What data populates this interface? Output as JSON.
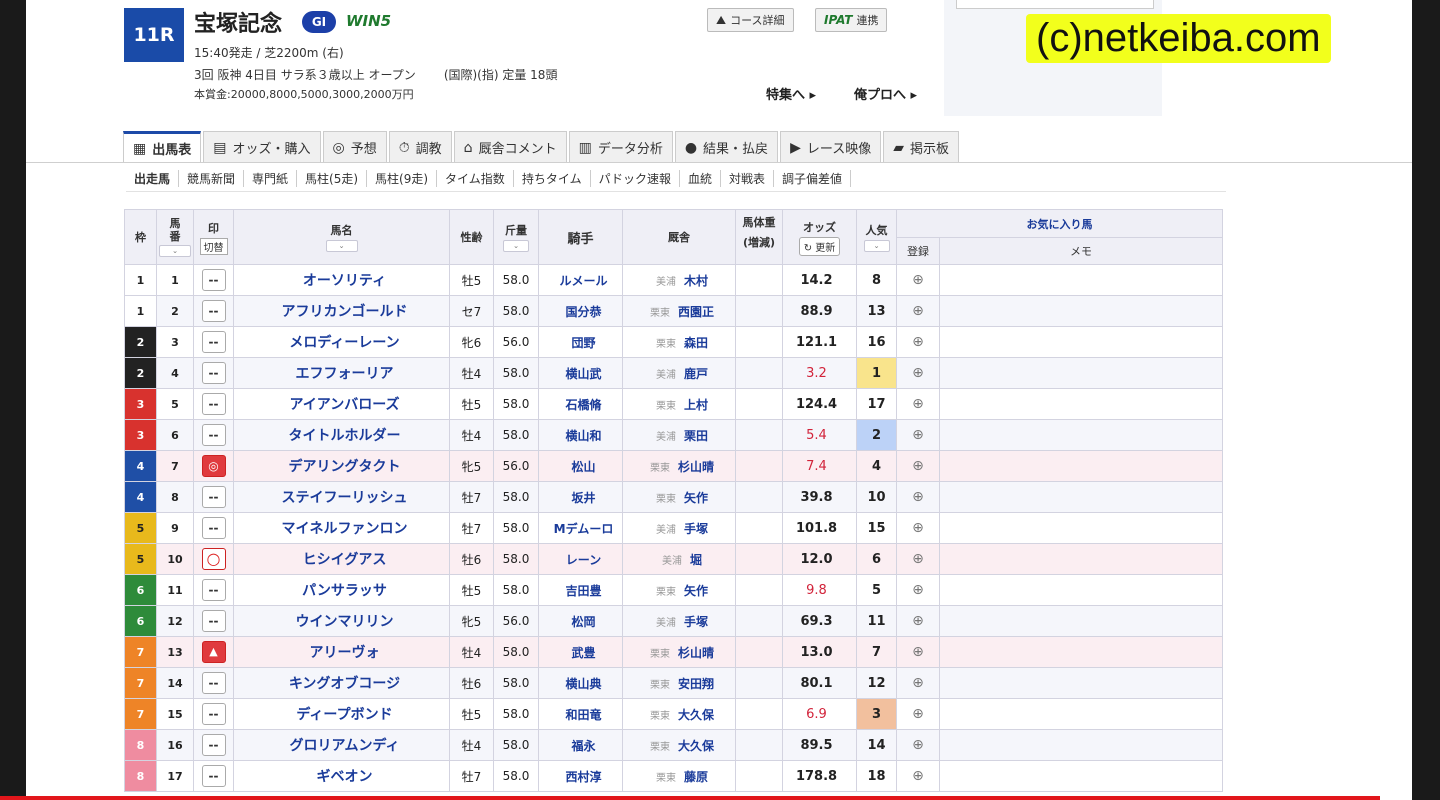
{
  "race": {
    "number": "11R",
    "name": "宝塚記念",
    "grade": "GI",
    "win5": "WIN5",
    "info_line1": "15:40発走 / 芝2200m (右)",
    "info_line2a": "3回 阪神 4日目 サラ系３歳以上 オープン",
    "info_line2b": "(国際)(指) 定量 18頭",
    "prize": "本賞金:20000,8000,5000,3000,2000万円"
  },
  "header": {
    "course_button": "コース詳細",
    "pat_logo": "IPAT",
    "pat_button": "連携",
    "feature_link": "特集へ ▸",
    "blog_link": "俺プロへ ▸",
    "watermark": "(c)netkeiba.com"
  },
  "tabs": [
    {
      "label": "出馬表",
      "icon": "table-icon",
      "glyph": "▦"
    },
    {
      "label": "オッズ・購入",
      "icon": "odds-icon",
      "glyph": "▤"
    },
    {
      "label": "予想",
      "icon": "target-icon",
      "glyph": "◎"
    },
    {
      "label": "調教",
      "icon": "stopwatch-icon",
      "glyph": "⏱"
    },
    {
      "label": "厩舎コメント",
      "icon": "stable-icon",
      "glyph": "⌂"
    },
    {
      "label": "データ分析",
      "icon": "bar-chart-icon",
      "glyph": "▥"
    },
    {
      "label": "結果・払戻",
      "icon": "coins-icon",
      "glyph": "●"
    },
    {
      "label": "レース映像",
      "icon": "video-icon",
      "glyph": "▶"
    },
    {
      "label": "掲示板",
      "icon": "chat-icon",
      "glyph": "▰"
    }
  ],
  "subnav": [
    "出走馬",
    "競馬新聞",
    "専門紙",
    "馬柱(5走)",
    "馬柱(9走)",
    "タイム指数",
    "持ちタイム",
    "パドック速報",
    "血統",
    "対戦表",
    "調子偏差値"
  ],
  "table": {
    "headers": {
      "waku": "枠",
      "umaban": "馬番",
      "mark": "印",
      "mark_toggle": "切替",
      "horse": "馬名",
      "sex_age": "性齢",
      "weight": "斤量",
      "jockey": "騎手",
      "trainer": "厩舎",
      "body_weight": "馬体重",
      "body_weight_sub": "(増減)",
      "odds": "オッズ",
      "odds_update": "更新",
      "popularity": "人気",
      "favorite": "お気に入り馬",
      "register": "登録",
      "memo": "メモ"
    },
    "rows": [
      {
        "waku": "1",
        "umaban": "1",
        "mark": "--",
        "horse": "オーソリティ",
        "sex_age": "牡5",
        "weight": "58.0",
        "jockey": "ルメール",
        "area": "美浦",
        "trainer": "木村",
        "odds": "14.2",
        "ninki": "8"
      },
      {
        "waku": "1",
        "umaban": "2",
        "mark": "--",
        "horse": "アフリカンゴールド",
        "sex_age": "セ7",
        "weight": "58.0",
        "jockey": "国分恭",
        "area": "栗東",
        "trainer": "西園正",
        "odds": "88.9",
        "ninki": "13"
      },
      {
        "waku": "2",
        "umaban": "3",
        "mark": "--",
        "horse": "メロディーレーン",
        "sex_age": "牝6",
        "weight": "56.0",
        "jockey": "団野",
        "area": "栗東",
        "trainer": "森田",
        "odds": "121.1",
        "ninki": "16"
      },
      {
        "waku": "2",
        "umaban": "4",
        "mark": "--",
        "horse": "エフフォーリア",
        "sex_age": "牡4",
        "weight": "58.0",
        "jockey": "横山武",
        "area": "美浦",
        "trainer": "鹿戸",
        "odds": "3.2",
        "ninki": "1"
      },
      {
        "waku": "3",
        "umaban": "5",
        "mark": "--",
        "horse": "アイアンバローズ",
        "sex_age": "牡5",
        "weight": "58.0",
        "jockey": "石橋脩",
        "area": "栗東",
        "trainer": "上村",
        "odds": "124.4",
        "ninki": "17"
      },
      {
        "waku": "3",
        "umaban": "6",
        "mark": "--",
        "horse": "タイトルホルダー",
        "sex_age": "牡4",
        "weight": "58.0",
        "jockey": "横山和",
        "area": "美浦",
        "trainer": "栗田",
        "odds": "5.4",
        "ninki": "2"
      },
      {
        "waku": "4",
        "umaban": "7",
        "mark": "◎",
        "horse": "デアリングタクト",
        "sex_age": "牝5",
        "weight": "56.0",
        "jockey": "松山",
        "area": "栗東",
        "trainer": "杉山晴",
        "odds": "7.4",
        "ninki": "4"
      },
      {
        "waku": "4",
        "umaban": "8",
        "mark": "--",
        "horse": "ステイフーリッシュ",
        "sex_age": "牡7",
        "weight": "58.0",
        "jockey": "坂井",
        "area": "栗東",
        "trainer": "矢作",
        "odds": "39.8",
        "ninki": "10"
      },
      {
        "waku": "5",
        "umaban": "9",
        "mark": "--",
        "horse": "マイネルファンロン",
        "sex_age": "牡7",
        "weight": "58.0",
        "jockey": "Mデムーロ",
        "area": "美浦",
        "trainer": "手塚",
        "odds": "101.8",
        "ninki": "15"
      },
      {
        "waku": "5",
        "umaban": "10",
        "mark": "○",
        "horse": "ヒシイグアス",
        "sex_age": "牡6",
        "weight": "58.0",
        "jockey": "レーン",
        "area": "美浦",
        "trainer": "堀",
        "odds": "12.0",
        "ninki": "6"
      },
      {
        "waku": "6",
        "umaban": "11",
        "mark": "--",
        "horse": "パンサラッサ",
        "sex_age": "牡5",
        "weight": "58.0",
        "jockey": "吉田豊",
        "area": "栗東",
        "trainer": "矢作",
        "odds": "9.8",
        "ninki": "5"
      },
      {
        "waku": "6",
        "umaban": "12",
        "mark": "--",
        "horse": "ウインマリリン",
        "sex_age": "牝5",
        "weight": "56.0",
        "jockey": "松岡",
        "area": "美浦",
        "trainer": "手塚",
        "odds": "69.3",
        "ninki": "11"
      },
      {
        "waku": "7",
        "umaban": "13",
        "mark": "▲",
        "horse": "アリーヴォ",
        "sex_age": "牡4",
        "weight": "58.0",
        "jockey": "武豊",
        "area": "栗東",
        "trainer": "杉山晴",
        "odds": "13.0",
        "ninki": "7"
      },
      {
        "waku": "7",
        "umaban": "14",
        "mark": "--",
        "horse": "キングオブコージ",
        "sex_age": "牡6",
        "weight": "58.0",
        "jockey": "横山典",
        "area": "栗東",
        "trainer": "安田翔",
        "odds": "80.1",
        "ninki": "12"
      },
      {
        "waku": "7",
        "umaban": "15",
        "mark": "--",
        "horse": "ディープボンド",
        "sex_age": "牡5",
        "weight": "58.0",
        "jockey": "和田竜",
        "area": "栗東",
        "trainer": "大久保",
        "odds": "6.9",
        "ninki": "3"
      },
      {
        "waku": "8",
        "umaban": "16",
        "mark": "--",
        "horse": "グロリアムンディ",
        "sex_age": "牡4",
        "weight": "58.0",
        "jockey": "福永",
        "area": "栗東",
        "trainer": "大久保",
        "odds": "89.5",
        "ninki": "14"
      },
      {
        "waku": "8",
        "umaban": "17",
        "mark": "--",
        "horse": "ギベオン",
        "sex_age": "牡7",
        "weight": "58.0",
        "jockey": "西村淳",
        "area": "栗東",
        "trainer": "藤原",
        "odds": "178.8",
        "ninki": "18"
      }
    ]
  },
  "colors": {
    "waku": {
      "1": "#ffffff",
      "2": "#222222",
      "3": "#d8322e",
      "4": "#1f4fa6",
      "5": "#e8b91c",
      "6": "#2e8b3a",
      "7": "#ee8427",
      "8": "#ef8ca0"
    },
    "popular": {
      "1": "#f9e48c",
      "2": "#bcd2f7",
      "3": "#f2c09e"
    },
    "accent": "#1d4aa8",
    "odds_hot": "#d2233a"
  },
  "icons": {
    "favorite_register": "add-favorite-icon",
    "refresh": "refresh-icon"
  }
}
